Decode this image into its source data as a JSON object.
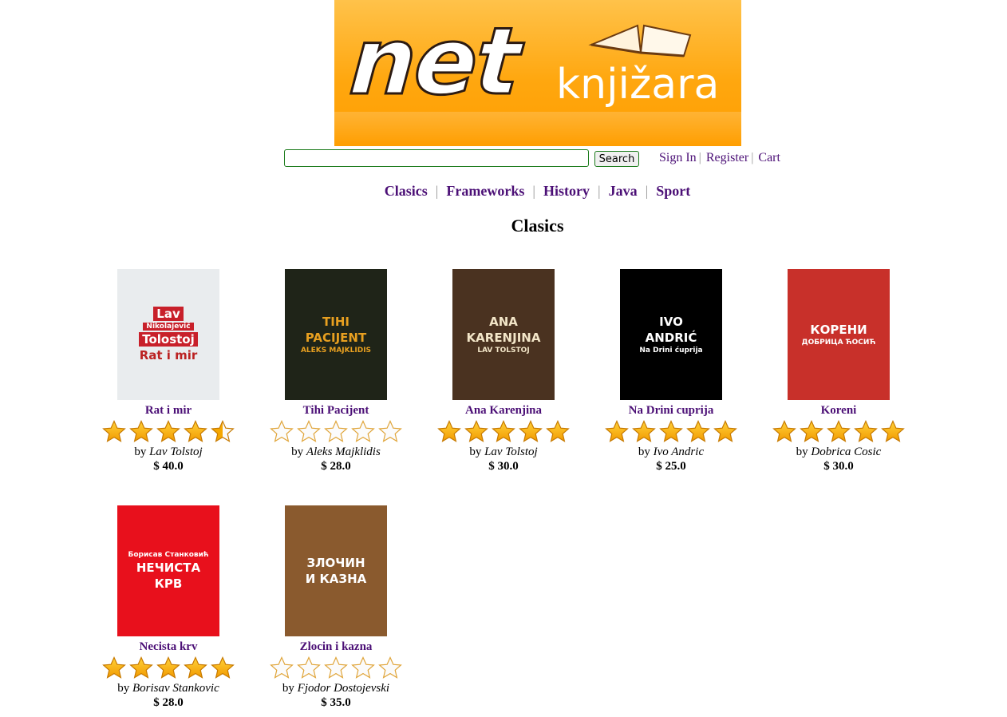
{
  "banner": {
    "brand": "net",
    "sub": "knjižara"
  },
  "search": {
    "value": "",
    "placeholder": "",
    "button": "Search"
  },
  "user_links": [
    "Sign In",
    "Register",
    "Cart"
  ],
  "categories": [
    "Clasics",
    "Frameworks",
    "History",
    "Java",
    "Sport"
  ],
  "page_title": "Clasics",
  "colors": {
    "link": "#4b0f76",
    "banner": "#ffa70f",
    "star": "#f5a700"
  },
  "books": [
    {
      "title": "Rat i mir",
      "author": "Lav Tolstoj",
      "price": "$ 40.0",
      "rating": 4.5,
      "cover_text": [
        "Lav",
        "Nikolajevič",
        "Tolostoj",
        "Rat i mir"
      ],
      "cover_bg": "#e9ecee"
    },
    {
      "title": "Tihi Pacijent",
      "author": "Aleks Majklidis",
      "price": "$ 28.0",
      "rating": 0,
      "cover_text": [
        "TIHI",
        "PACIJENT",
        "ALEKS MAJKLIDIS"
      ],
      "cover_bg": "#1f2418"
    },
    {
      "title": "Ana Karenjina",
      "author": "Lav Tolstoj",
      "price": "$ 30.0",
      "rating": 5,
      "cover_text": [
        "ANA",
        "KARENJINA",
        "LAV TOLSTOJ"
      ],
      "cover_bg": "#4a3220"
    },
    {
      "title": "Na Drini cuprija",
      "author": "Ivo Andric",
      "price": "$ 25.0",
      "rating": 5,
      "cover_text": [
        "IVO",
        "ANDRIĆ",
        "Na Drini ćuprija"
      ],
      "cover_bg": "#000000"
    },
    {
      "title": "Koreni",
      "author": "Dobrica Cosic",
      "price": "$ 30.0",
      "rating": 5,
      "cover_text": [
        "КОРЕНИ",
        "ДОБРИЦА ЋОСИЋ"
      ],
      "cover_bg": "#c8302a"
    },
    {
      "title": "Necista krv",
      "author": "Borisav Stankovic",
      "price": "$ 28.0",
      "rating": 5,
      "cover_text": [
        "Борисав Станковић",
        "НЕЧИСТА",
        "КРВ"
      ],
      "cover_bg": "#e8101c"
    },
    {
      "title": "Zlocin i kazna",
      "author": "Fjodor Dostojevski",
      "price": "$ 35.0",
      "rating": 0,
      "cover_text": [
        "ЗЛОЧИН",
        "И КАЗНА"
      ],
      "cover_bg": "#8a5a2e"
    }
  ]
}
